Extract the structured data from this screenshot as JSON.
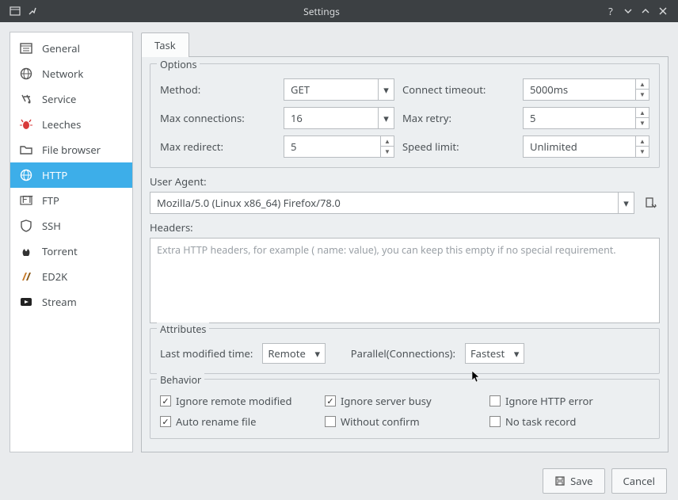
{
  "window": {
    "title": "Settings"
  },
  "sidebar": {
    "items": [
      {
        "label": "General"
      },
      {
        "label": "Network"
      },
      {
        "label": "Service"
      },
      {
        "label": "Leeches"
      },
      {
        "label": "File browser"
      },
      {
        "label": "HTTP"
      },
      {
        "label": "FTP"
      },
      {
        "label": "SSH"
      },
      {
        "label": "Torrent"
      },
      {
        "label": "ED2K"
      },
      {
        "label": "Stream"
      }
    ]
  },
  "tab": {
    "label": "Task"
  },
  "options": {
    "title": "Options",
    "method_label": "Method:",
    "method_value": "GET",
    "connect_timeout_label": "Connect timeout:",
    "connect_timeout_value": "5000ms",
    "max_conn_label": "Max connections:",
    "max_conn_value": "16",
    "max_retry_label": "Max retry:",
    "max_retry_value": "5",
    "max_redirect_label": "Max redirect:",
    "max_redirect_value": "5",
    "speed_limit_label": "Speed limit:",
    "speed_limit_value": "Unlimited"
  },
  "user_agent": {
    "label": "User Agent:",
    "value": "Mozilla/5.0 (Linux x86_64) Firefox/78.0"
  },
  "headers": {
    "label": "Headers:",
    "placeholder": "Extra HTTP headers, for example ( name: value), you can keep this empty if no special requirement."
  },
  "attributes": {
    "title": "Attributes",
    "lastmod_label": "Last modified time:",
    "lastmod_value": "Remote",
    "parallel_label": "Parallel(Connections):",
    "parallel_value": "Fastest"
  },
  "behavior": {
    "title": "Behavior",
    "items": [
      {
        "label": "Ignore remote modified",
        "checked": true
      },
      {
        "label": "Ignore server busy",
        "checked": true
      },
      {
        "label": "Ignore HTTP error",
        "checked": false
      },
      {
        "label": "Auto rename file",
        "checked": true
      },
      {
        "label": "Without confirm",
        "checked": false
      },
      {
        "label": "No task record",
        "checked": false
      }
    ]
  },
  "footer": {
    "save": "Save",
    "cancel": "Cancel"
  }
}
